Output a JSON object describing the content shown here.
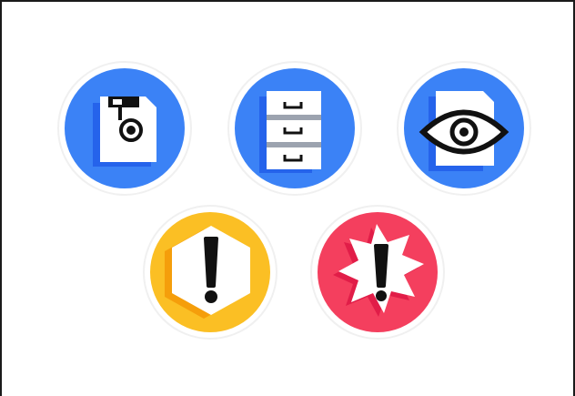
{
  "colors": {
    "blue": "#3B82F6",
    "blue_dark": "#2563EB",
    "yellow": "#FBBF24",
    "yellow_dark": "#F59E0B",
    "red": "#F43F5E",
    "red_dark": "#E11D48",
    "ink": "#111111",
    "paper": "#FFFFFF",
    "steel": "#9CA3AF"
  },
  "icons": [
    {
      "name": "save-file-icon",
      "style": "blue-circle"
    },
    {
      "name": "file-cabinet-icon",
      "style": "blue-circle"
    },
    {
      "name": "view-file-icon",
      "style": "blue-circle"
    },
    {
      "name": "warning-icon",
      "style": "yellow-circle"
    },
    {
      "name": "alert-burst-icon",
      "style": "red-circle"
    }
  ]
}
